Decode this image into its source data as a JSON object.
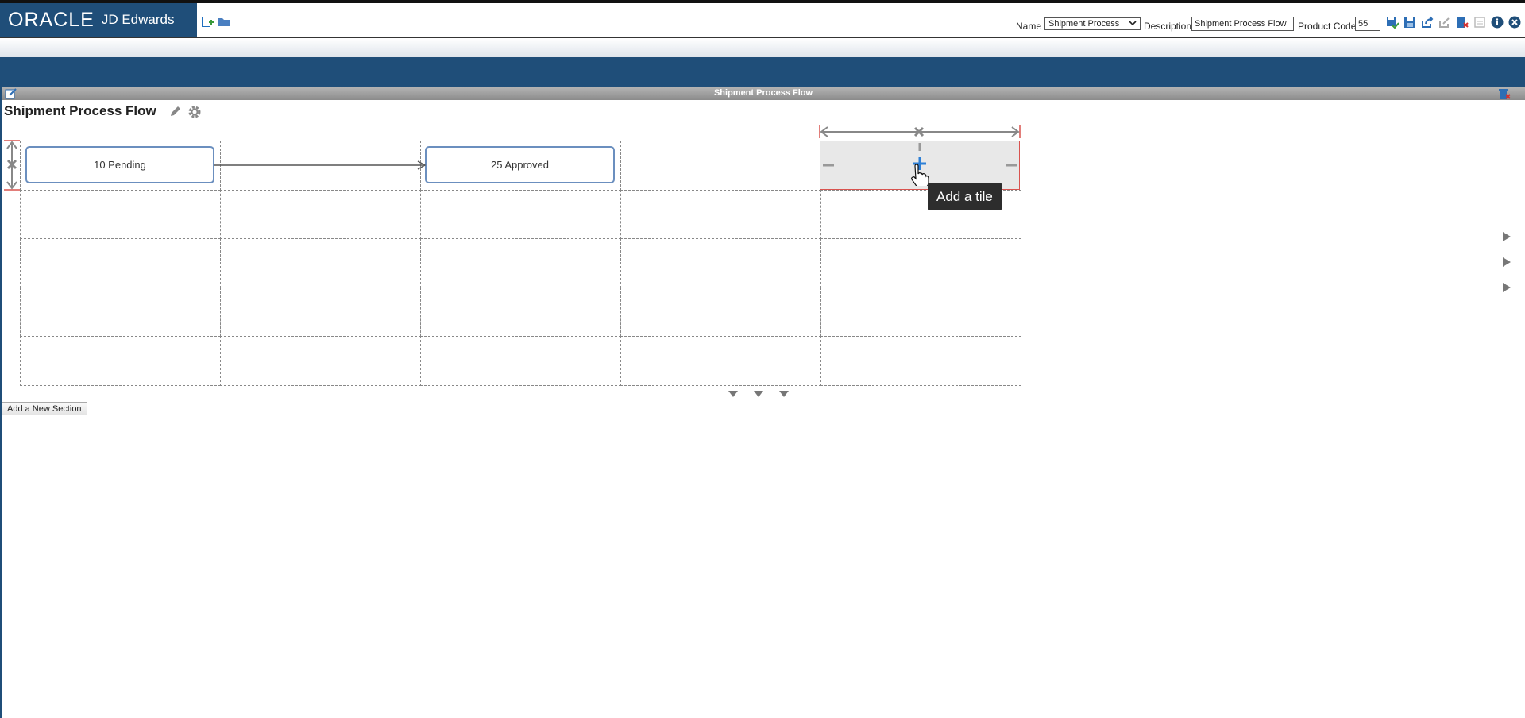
{
  "brand": {
    "oracle": "ORACLE",
    "product": "JD Edwards"
  },
  "toolbar": {
    "name_label": "Name",
    "name_value": "Shipment Process",
    "description_label": "Description",
    "description_value": "Shipment Process Flow",
    "product_code_label": "Product Code",
    "product_code_value": "55",
    "icons": [
      "new-page-icon",
      "open-folder-icon",
      "save-icon",
      "save-as-icon",
      "share-icon",
      "request-publish-icon",
      "delete-icon",
      "reserve-icon",
      "info-icon",
      "close-icon"
    ]
  },
  "window": {
    "title": "Shipment Process Flow"
  },
  "page": {
    "title": "Shipment Process Flow"
  },
  "tiles": [
    {
      "label": "10 Pending"
    },
    {
      "label": "25 Approved"
    }
  ],
  "tooltip": {
    "text": "Add a tile"
  },
  "add_section_label": "Add a New Section",
  "colors": {
    "brand_blue": "#1f4e79",
    "tile_border": "#6b8fbf",
    "selection_red": "#d9534f",
    "tooltip_bg": "#2d2d2d"
  }
}
